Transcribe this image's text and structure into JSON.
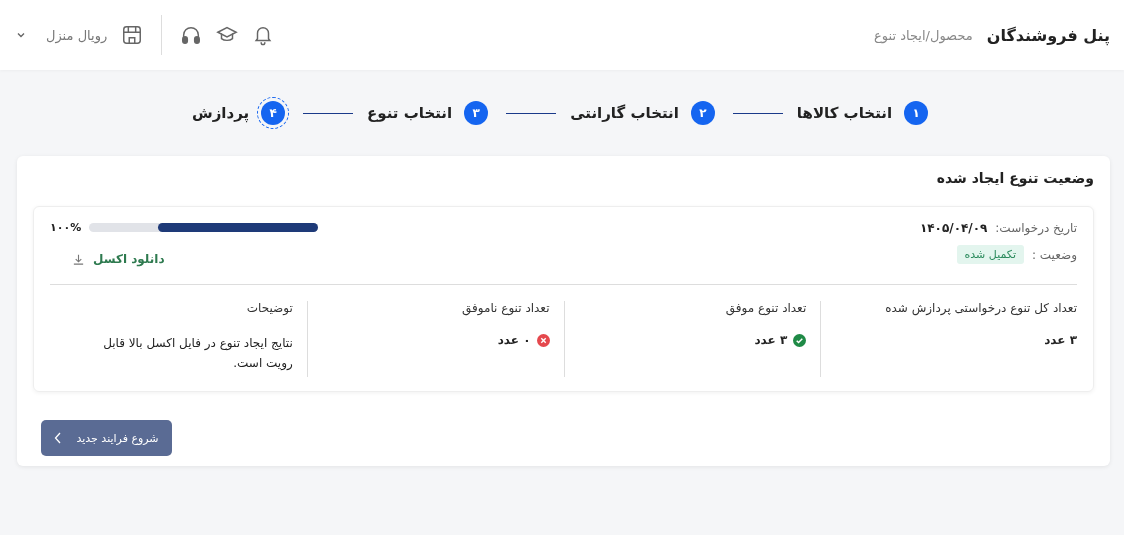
{
  "header": {
    "title": "پنل فروشندگان",
    "breadcrumb": "محصول/ایجاد تنوع",
    "store_name": "رویال منزل"
  },
  "steps": [
    {
      "number": "۱",
      "label": "انتخاب کالاها",
      "selected": false
    },
    {
      "number": "۲",
      "label": "انتخاب گارانتی",
      "selected": false
    },
    {
      "number": "۳",
      "label": "انتخاب تنوع",
      "selected": false
    },
    {
      "number": "۴",
      "label": "پردازش",
      "selected": true
    }
  ],
  "panel": {
    "title": "وضعیت تنوع ایجاد شده",
    "date_label": "تاریخ درخواست:",
    "date": "۱۴۰۵/۰۴/۰۹",
    "status_label": "وضعیت :",
    "status": "تکمیل شده",
    "progress": {
      "level": 0.7,
      "reading": "۱۰۰%"
    },
    "download": "دانلود اکسل",
    "stats": [
      {
        "kind": "plain",
        "label": "تعداد کل تنوع درخواستی پردازش شده",
        "value": "۳ عدد"
      },
      {
        "kind": "success",
        "label": "تعداد تنوع موفق",
        "value": "۳ عدد"
      },
      {
        "kind": "failure",
        "label": "تعداد تنوع ناموفق",
        "value": "۰ عدد"
      },
      {
        "kind": "note",
        "label": "توضیحات",
        "value": "نتایج ایجاد تنوع در فایل اکسل بالا قابل رویت است."
      }
    ]
  },
  "button": "شروع فرایند جدید"
}
